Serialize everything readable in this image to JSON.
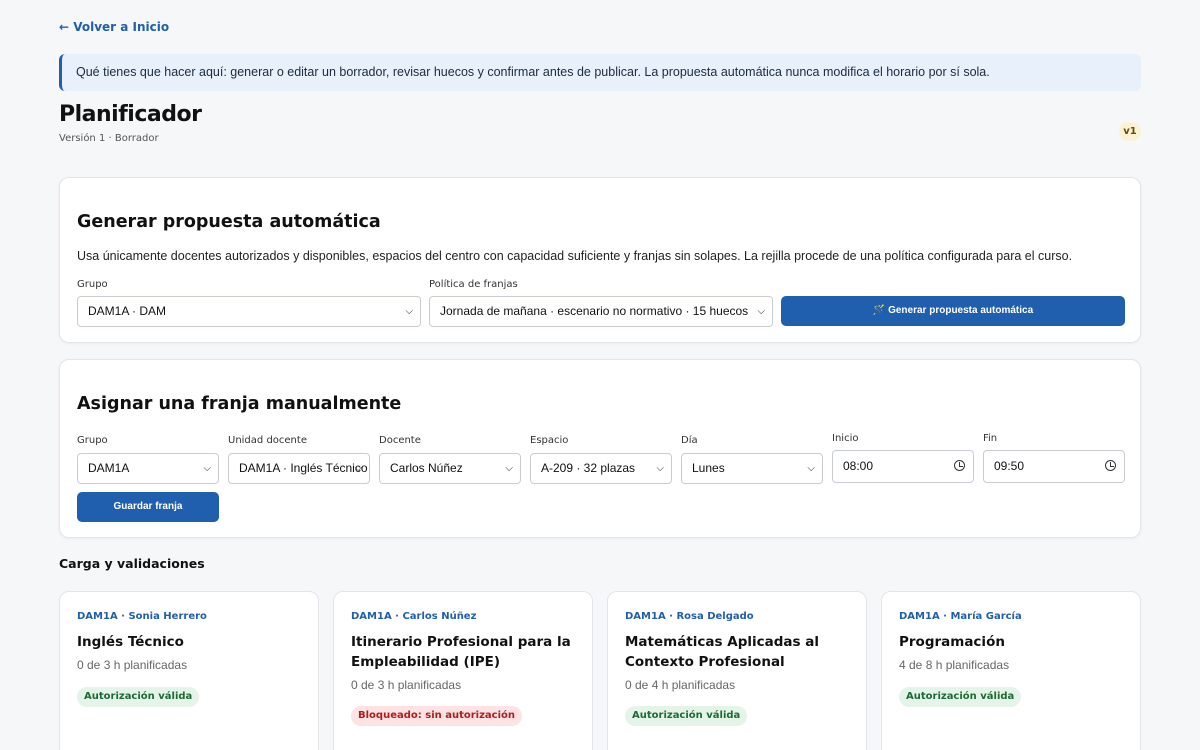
{
  "nav": {
    "back_label": "← Volver a Inicio"
  },
  "info": {
    "text": "Qué tienes que hacer aquí: generar o editar un borrador, revisar huecos y confirmar antes de publicar. La propuesta automática nunca modifica el horario por sí sola."
  },
  "header": {
    "title": "Planificador",
    "subtitle": "Versión 1 · Borrador",
    "version_badge": "v1"
  },
  "auto": {
    "title": "Generar propuesta automática",
    "description": "Usa únicamente docentes autorizados y disponibles, espacios del centro con capacidad suficiente y franjas sin solapes. La rejilla procede de una política configurada para el curso.",
    "group_label": "Grupo",
    "group_value": "DAM1A · DAM",
    "policy_label": "Política de franjas",
    "policy_value": "Jornada de mañana · escenario no normativo · 15 huecos",
    "button_label": "🪄 Generar propuesta automática"
  },
  "manual": {
    "title": "Asignar una franja manualmente",
    "fields": {
      "group": {
        "label": "Grupo",
        "value": "DAM1A"
      },
      "unit": {
        "label": "Unidad docente",
        "value": "DAM1A · Inglés Técnico"
      },
      "teacher": {
        "label": "Docente",
        "value": "Carlos Núñez"
      },
      "space": {
        "label": "Espacio",
        "value": "A-209 · 32 plazas"
      },
      "day": {
        "label": "Día",
        "value": "Lunes"
      },
      "start": {
        "label": "Inicio",
        "value": "08:00"
      },
      "end": {
        "label": "Fin",
        "value": "09:50"
      }
    },
    "save_label": "Guardar franja"
  },
  "load": {
    "title": "Carga y validaciones",
    "cards": [
      {
        "meta": "DAM1A · Sonia Herrero",
        "subject": "Inglés Técnico",
        "hours": "0 de 3 h planificadas",
        "status": "Autorización válida"
      },
      {
        "meta": "DAM1A · Carlos Núñez",
        "subject": "Itinerario Profesional para la Empleabilidad (IPE)",
        "hours": "0 de 3 h planificadas",
        "status": "Bloqueado: sin autorización"
      },
      {
        "meta": "DAM1A · Rosa Delgado",
        "subject": "Matemáticas Aplicadas al Contexto Profesional",
        "hours": "0 de 4 h planificadas",
        "status": "Autorización válida"
      },
      {
        "meta": "DAM1A · María García",
        "subject": "Programación",
        "hours": "4 de 8 h planificadas",
        "status": "Autorización válida"
      }
    ]
  },
  "colors": {
    "accent": "#1f5fad",
    "ok": "#1d6a33",
    "blocked": "#b01c1c",
    "info_bg": "#e8f0fb"
  },
  "icons": {
    "dropdown": "chevron-down-icon",
    "time": "clock-icon",
    "generate": "magic-wand-icon"
  }
}
